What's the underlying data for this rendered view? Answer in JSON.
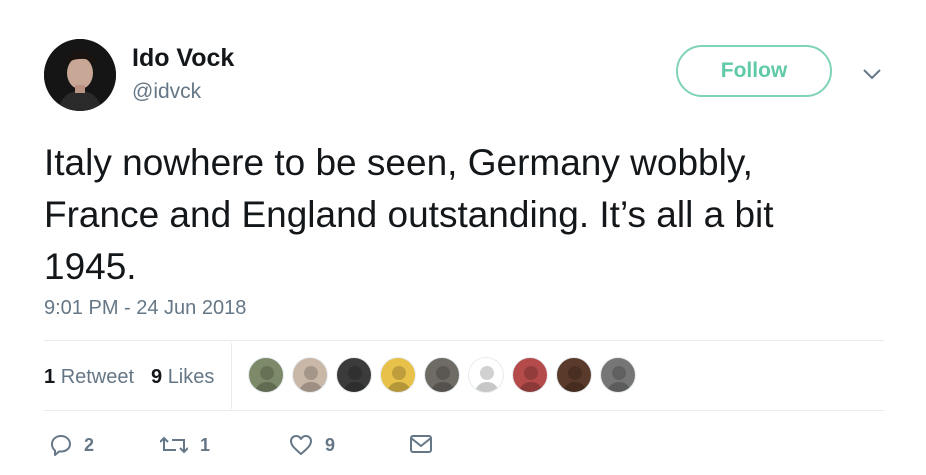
{
  "author": {
    "name": "Ido Vock",
    "handle": "@idvck"
  },
  "follow_label": "Follow",
  "tweet": {
    "text": "Italy nowhere to be seen, Germany wobbly,\nFrance and England outstanding. It’s all a bit\n1945."
  },
  "timestamp": "9:01 PM - 24 Jun 2018",
  "stats": {
    "retweets_count": "1",
    "retweets_label": "Retweet",
    "likes_count": "9",
    "likes_label": "Likes"
  },
  "liker_avatars": [
    {
      "name": "liker-avatar-1",
      "color": "#7d8a6a"
    },
    {
      "name": "liker-avatar-2",
      "color": "#c9b8a8"
    },
    {
      "name": "liker-avatar-3",
      "color": "#3b3b3b"
    },
    {
      "name": "liker-avatar-4",
      "color": "#e8c14a"
    },
    {
      "name": "liker-avatar-5",
      "color": "#6e6a64"
    },
    {
      "name": "liker-avatar-6",
      "color": "#ffffff"
    },
    {
      "name": "liker-avatar-7",
      "color": "#b44a4a"
    },
    {
      "name": "liker-avatar-8",
      "color": "#5a3a2a"
    },
    {
      "name": "liker-avatar-9",
      "color": "#767676"
    }
  ],
  "actions": {
    "reply_count": "2",
    "retweet_count": "1",
    "like_count": "9"
  },
  "colors": {
    "follow_accent": "#5fc9a8",
    "muted": "#657786",
    "text": "#14171a"
  },
  "icons": [
    "chevron-down-icon",
    "reply-icon",
    "retweet-icon",
    "like-icon",
    "message-icon"
  ]
}
